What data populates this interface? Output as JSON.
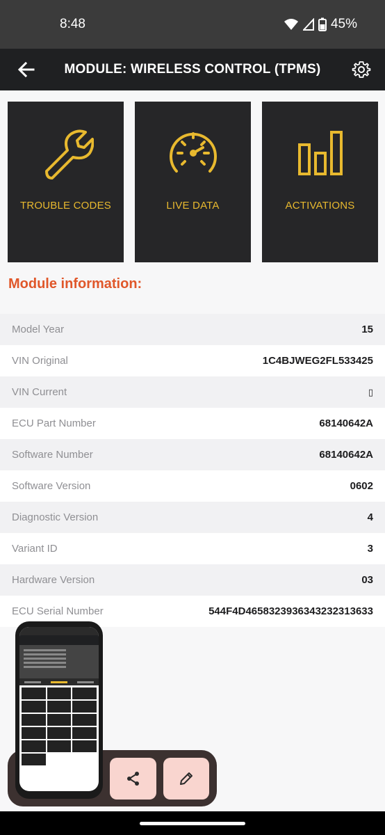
{
  "status": {
    "time": "8:48",
    "battery": "45%"
  },
  "header": {
    "title": "MODULE: WIRELESS CONTROL (TPMS)"
  },
  "tiles": [
    {
      "label": "TROUBLE CODES",
      "icon": "wrench-icon"
    },
    {
      "label": "LIVE DATA",
      "icon": "gauge-icon"
    },
    {
      "label": "ACTIVATIONS",
      "icon": "bar-chart-icon"
    }
  ],
  "section": {
    "title": "Module information:"
  },
  "info": [
    {
      "label": "Model Year",
      "value": "15"
    },
    {
      "label": "VIN Original",
      "value": "1C4BJWEG2FL533425"
    },
    {
      "label": "VIN Current",
      "value": "▯"
    },
    {
      "label": "ECU Part Number",
      "value": "68140642A"
    },
    {
      "label": "Software Number",
      "value": "68140642A"
    },
    {
      "label": "Software Version",
      "value": "0602"
    },
    {
      "label": "Diagnostic Version",
      "value": "4"
    },
    {
      "label": "Variant ID",
      "value": "3"
    },
    {
      "label": "Hardware Version",
      "value": "03"
    },
    {
      "label": "ECU Serial Number",
      "value": "544F4D4658323936343232313633"
    }
  ],
  "colors": {
    "accent": "#e8b92f",
    "section_title": "#e0572a",
    "tile_bg": "#262628",
    "app_bar": "#1f2022",
    "action_button": "#f9d5cf"
  },
  "actions": {
    "share_icon": "share-icon",
    "edit_icon": "pencil-icon"
  }
}
